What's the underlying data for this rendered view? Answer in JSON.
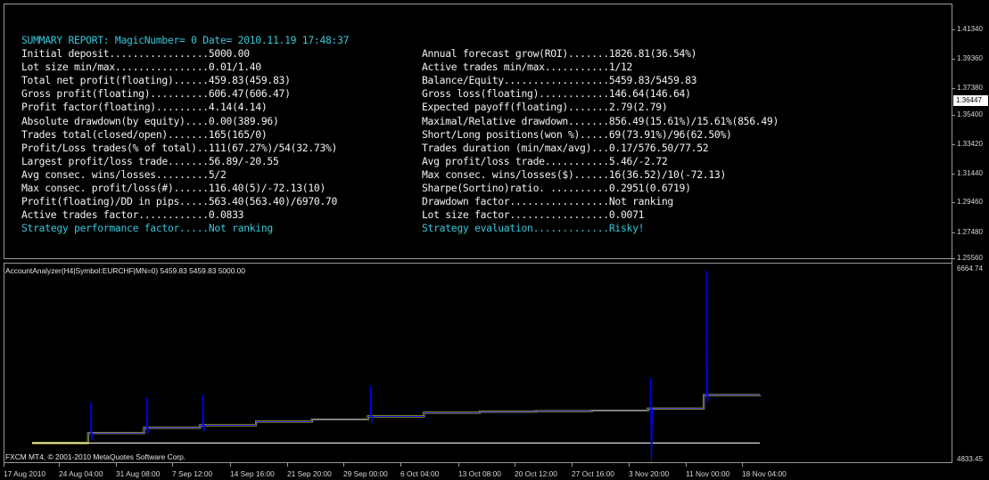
{
  "report": {
    "header": "SUMMARY REPORT: MagicNumber= 0 Date= 2010.11.19 17:48:37",
    "left": [
      {
        "text": "Initial deposit.................5000.00",
        "highlight": false
      },
      {
        "text": "Lot size min/max................0.01/1.40",
        "highlight": false
      },
      {
        "text": "Total net profit(floating)......459.83(459.83)",
        "highlight": false
      },
      {
        "text": "Gross profit(floating)..........606.47(606.47)",
        "highlight": false
      },
      {
        "text": "Profit factor(floating).........4.14(4.14)",
        "highlight": false
      },
      {
        "text": "Absolute drawdown(by equity)....0.00(389.96)",
        "highlight": false
      },
      {
        "text": "Trades total(closed/open).......165(165/0)",
        "highlight": false
      },
      {
        "text": "Profit/Loss trades(% of total)..111(67.27%)/54(32.73%)",
        "highlight": false
      },
      {
        "text": "Largest profit/loss trade.......56.89/-20.55",
        "highlight": false
      },
      {
        "text": "Avg consec. wins/losses.........5/2",
        "highlight": false
      },
      {
        "text": "Max consec. profit/loss(#)......116.40(5)/-72.13(10)",
        "highlight": false
      },
      {
        "text": "Profit(floating)/DD in pips.....563.40(563.40)/6970.70",
        "highlight": false
      },
      {
        "text": "Active trades factor............0.0833",
        "highlight": false
      },
      {
        "text": "Strategy performance factor.....Not ranking",
        "highlight": true
      }
    ],
    "right": [
      {
        "text": "Annual forecast grow(ROI).......1826.81(36.54%)",
        "highlight": false
      },
      {
        "text": "Active trades min/max...........1/12",
        "highlight": false
      },
      {
        "text": "Balance/Equity..................5459.83/5459.83",
        "highlight": false
      },
      {
        "text": "Gross loss(floating)............146.64(146.64)",
        "highlight": false
      },
      {
        "text": "Expected payoff(floating).......2.79(2.79)",
        "highlight": false
      },
      {
        "text": "Maximal/Relative drawdown.......856.49(15.61%)/15.61%(856.49)",
        "highlight": false
      },
      {
        "text": "Short/Long positions(won %).....69(73.91%)/96(62.50%)",
        "highlight": false
      },
      {
        "text": "Trades duration (min/max/avg)...0.17/576.50/77.52",
        "highlight": false
      },
      {
        "text": "Avg profit/loss trade...........5.46/-2.72",
        "highlight": false
      },
      {
        "text": "Max consec. wins/losses($)......16(36.52)/10(-72.13)",
        "highlight": false
      },
      {
        "text": "Sharpe(Sortino)ratio. ..........0.2951(0.6719)",
        "highlight": false
      },
      {
        "text": "Drawdown factor.................Not ranking",
        "highlight": false
      },
      {
        "text": "Lot size factor.................0.0071",
        "highlight": false
      },
      {
        "text": "Strategy evaluation.............Risky!",
        "highlight": true
      }
    ]
  },
  "price_axis": {
    "labels": [
      "1.41340",
      "1.39360",
      "1.37380",
      "1.35400",
      "1.33420",
      "1.31440",
      "1.29460",
      "1.27480",
      "1.25560"
    ],
    "current": "1.36447"
  },
  "indicator": {
    "title": "AccountAnalyzer(H4|Symbol:EURCHF|MN=0) 5459.83 5459.83 5000.00",
    "axis_max": "6664.74",
    "axis_min": "4833.45"
  },
  "time_axis": [
    "17 Aug 2010",
    "24 Aug 04:00",
    "31 Aug 08:00",
    "7 Sep 12:00",
    "14 Sep 16:00",
    "21 Sep 20:00",
    "29 Sep 00:00",
    "6 Oct 04:00",
    "13 Oct 08:00",
    "20 Oct 12:00",
    "27 Oct 16:00",
    "3 Nov 20:00",
    "11 Nov 00:00",
    "18 Nov 04:00"
  ],
  "copyright": "FXCM MT4, © 2001-2010 MetaQuotes Software Corp.",
  "colors": {
    "balance": "#ffff00",
    "equity": "#0000ff",
    "baseline": "#ffffff",
    "report_text": "#f2f2f2",
    "report_highlight": "#39c6d8",
    "grid": "#9a9a9a"
  },
  "chart_data": {
    "type": "line",
    "ylim": [
      4833.45,
      6664.74
    ],
    "x": [
      "17 Aug 2010",
      "24 Aug 04:00",
      "31 Aug 08:00",
      "7 Sep 12:00",
      "14 Sep 16:00",
      "21 Sep 20:00",
      "29 Sep 00:00",
      "6 Oct 04:00",
      "13 Oct 08:00",
      "20 Oct 12:00",
      "27 Oct 16:00",
      "3 Nov 20:00",
      "11 Nov 00:00",
      "18 Nov 04:00"
    ],
    "series": [
      {
        "name": "",
        "color": "#ffff00",
        "values": [
          5000,
          5095,
          5145,
          5170,
          5205,
          5225,
          5255,
          5290,
          5300,
          5305,
          5310,
          5330,
          5458,
          5459.83
        ]
      },
      {
        "name": "",
        "color": "#0000ff",
        "values": [
          5000,
          5095,
          5145,
          5170,
          5205,
          5225,
          5255,
          5290,
          5300,
          5305,
          5310,
          5330,
          5458,
          5459.83
        ]
      },
      {
        "name": "",
        "color": "#ffffff",
        "values": [
          5000,
          5000,
          5000,
          5000,
          5000,
          5000,
          5000,
          5000,
          5000,
          5000,
          5000,
          5000,
          5000,
          5000
        ]
      }
    ]
  }
}
